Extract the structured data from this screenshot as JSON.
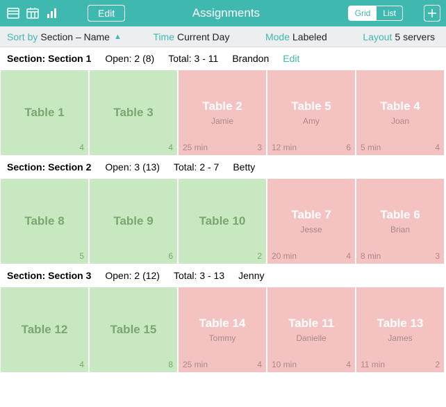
{
  "header": {
    "title": "Assignments",
    "edit": "Edit",
    "grid": "Grid",
    "list": "List"
  },
  "filters": {
    "sort_lbl": "Sort by",
    "sort_val": "Section – Name",
    "time_lbl": "Time",
    "time_val": "Current Day",
    "mode_lbl": "Mode",
    "mode_val": "Labeled",
    "layout_lbl": "Layout",
    "layout_val": "5 servers"
  },
  "sections": [
    {
      "title": "Section: Section 1",
      "open": "Open: 2 (8)",
      "total": "Total: 3 - 11",
      "owner": "Brandon",
      "edit": "Edit",
      "tiles": [
        {
          "name": "Table 1",
          "type": "green",
          "br": "4"
        },
        {
          "name": "Table 3",
          "type": "green",
          "br": "4"
        },
        {
          "name": "Table 2",
          "type": "pink",
          "server": "Jamie",
          "bl": "25 min",
          "br": "3"
        },
        {
          "name": "Table 5",
          "type": "pink",
          "server": "Amy",
          "bl": "12 min",
          "br": "6"
        },
        {
          "name": "Table 4",
          "type": "pink",
          "server": "Joan",
          "bl": "5 min",
          "br": "4"
        }
      ]
    },
    {
      "title": "Section: Section 2",
      "open": "Open: 3 (13)",
      "total": "Total: 2 - 7",
      "owner": "Betty",
      "tiles": [
        {
          "name": "Table 8",
          "type": "green",
          "br": "5"
        },
        {
          "name": "Table 9",
          "type": "green",
          "br": "6"
        },
        {
          "name": "Table 10",
          "type": "green",
          "br": "2"
        },
        {
          "name": "Table 7",
          "type": "pink",
          "server": "Jesse",
          "bl": "20 min",
          "br": "4"
        },
        {
          "name": "Table 6",
          "type": "pink",
          "server": "Brian",
          "bl": "8 min",
          "br": "3"
        }
      ]
    },
    {
      "title": "Section: Section 3",
      "open": "Open: 2 (12)",
      "total": "Total: 3 - 13",
      "owner": "Jenny",
      "tiles": [
        {
          "name": "Table 12",
          "type": "green",
          "br": "4"
        },
        {
          "name": "Table 15",
          "type": "green",
          "br": "8"
        },
        {
          "name": "Table 14",
          "type": "pink",
          "server": "Tommy",
          "bl": "25 min",
          "br": "4"
        },
        {
          "name": "Table 11",
          "type": "pink",
          "server": "Danielle",
          "bl": "10 min",
          "br": "4"
        },
        {
          "name": "Table 13",
          "type": "pink",
          "server": "James",
          "bl": "11 min",
          "br": "2"
        }
      ]
    }
  ]
}
